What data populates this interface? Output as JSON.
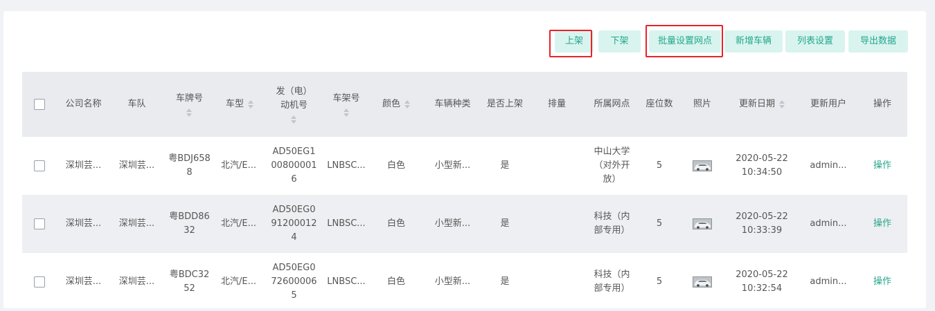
{
  "toolbar": {
    "buttons": [
      {
        "label": "上架"
      },
      {
        "label": "下架"
      },
      {
        "label": "批量设置网点"
      },
      {
        "label": "新增车辆"
      },
      {
        "label": "列表设置"
      },
      {
        "label": "导出数据"
      }
    ],
    "highlight_color": "#e8222a",
    "accent_color": "#23a68c"
  },
  "table": {
    "headers": [
      "公司名称",
      "车队",
      "车牌号",
      "车型",
      "发（电）\n动机号",
      "车架号",
      "颜色",
      "车辆种类",
      "是否上架",
      "排量",
      "所属网点",
      "座位数",
      "照片",
      "更新日期",
      "更新用户",
      "操作"
    ],
    "rows": [
      {
        "company": "深圳芸...",
        "fleet": "深圳芸...",
        "plate": "粤BDJ658\n8",
        "model": "北汽/E...",
        "engine": "AD50EG1\n00800001\n6",
        "frame": "LNBSC...",
        "color": "白色",
        "type": "小型新...",
        "listed": "是",
        "displacement": "",
        "outlet": "中山大学\n（对外开\n放）",
        "seats": "5",
        "photo_icon": "car-photo-icon",
        "date": "2020-05-22\n10:34:50",
        "user": "admin...",
        "action": "操作"
      },
      {
        "company": "深圳芸...",
        "fleet": "深圳芸...",
        "plate": "粤BDD86\n32",
        "model": "北汽/E...",
        "engine": "AD50EG0\n91200012\n4",
        "frame": "LNBSC...",
        "color": "白色",
        "type": "小型新...",
        "listed": "是",
        "displacement": "",
        "outlet": "科技（内\n部专用）",
        "seats": "5",
        "photo_icon": "car-photo-icon",
        "date": "2020-05-22\n10:33:39",
        "user": "admin...",
        "action": "操作"
      },
      {
        "company": "深圳芸...",
        "fleet": "深圳芸...",
        "plate": "粤BDC32\n52",
        "model": "北汽/E...",
        "engine": "AD50EG0\n72600006\n5",
        "frame": "LNBSC...",
        "color": "白色",
        "type": "小型新...",
        "listed": "是",
        "displacement": "",
        "outlet": "科技（内\n部专用）",
        "seats": "5",
        "photo_icon": "car-photo-icon",
        "date": "2020-05-22\n10:32:54",
        "user": "admin...",
        "action": "操作"
      }
    ]
  }
}
